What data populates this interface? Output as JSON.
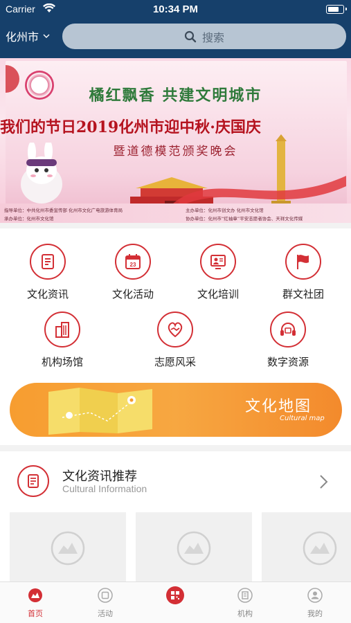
{
  "status_bar": {
    "carrier": "Carrier",
    "time": "10:34 PM"
  },
  "header": {
    "city": "化州市",
    "search_placeholder": "搜索"
  },
  "banner": {
    "line1": "橘红飘香  共建文明城市",
    "line2": "我们的节日2019化州市迎中秋·庆国庆",
    "line3": "暨道德模范颁奖晚会",
    "foot_left1": "指导单位：中共化州市委宣传部 化州市文化广电旅游体育局",
    "foot_left2": "承办单位：化州市文化馆",
    "foot_right1": "主办单位：化州市创文办 化州市文化馆",
    "foot_right2": "协办单位：化州市“红袖章”平安志愿者协会、天祥文化传媒"
  },
  "grid": {
    "items": [
      {
        "label": "文化资讯",
        "icon": "document-icon"
      },
      {
        "label": "文化活动",
        "icon": "calendar-icon"
      },
      {
        "label": "文化培训",
        "icon": "training-icon"
      },
      {
        "label": "群文社团",
        "icon": "flag-icon"
      },
      {
        "label": "机构场馆",
        "icon": "building-icon"
      },
      {
        "label": "志愿风采",
        "icon": "handshake-icon"
      },
      {
        "label": "数字资源",
        "icon": "headphones-icon"
      }
    ]
  },
  "map_banner": {
    "title": "文化地图",
    "subtitle": "Cultural map"
  },
  "recommend": {
    "title": "文化资讯推荐",
    "subtitle": "Cultural Information"
  },
  "tabbar": {
    "items": [
      {
        "label": "首页",
        "active": true
      },
      {
        "label": "活动",
        "active": false
      },
      {
        "label": "",
        "active": false
      },
      {
        "label": "机构",
        "active": false
      },
      {
        "label": "我的",
        "active": false
      }
    ]
  },
  "colors": {
    "header": "#16406b",
    "accent": "#d32f35",
    "map_orange": "#f79d30"
  }
}
